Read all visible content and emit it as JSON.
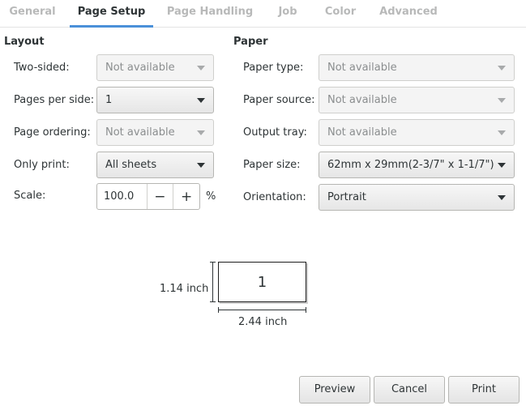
{
  "tabs": [
    "General",
    "Page Setup",
    "Page Handling",
    "Job",
    "Color",
    "Advanced"
  ],
  "layout": {
    "heading": "Layout",
    "two_sided": {
      "label": "Two-sided:",
      "value": "Not available"
    },
    "pages_per_side": {
      "label": "Pages per side:",
      "value": "1"
    },
    "page_ordering": {
      "label": "Page ordering:",
      "value": "Not available"
    },
    "only_print": {
      "label": "Only print:",
      "value": "All sheets"
    },
    "scale": {
      "label": "Scale:",
      "value": "100.0",
      "minus": "−",
      "plus": "+",
      "unit": "%"
    }
  },
  "paper": {
    "heading": "Paper",
    "paper_type": {
      "label": "Paper type:",
      "value": "Not available"
    },
    "paper_source": {
      "label": "Paper source:",
      "value": "Not available"
    },
    "output_tray": {
      "label": "Output tray:",
      "value": "Not available"
    },
    "paper_size": {
      "label": "Paper size:",
      "value": "62mm x 29mm(2-3/7\" x 1-1/7\")"
    },
    "orientation": {
      "label": "Orientation:",
      "value": "Portrait"
    }
  },
  "preview": {
    "page_number": "1",
    "height_label": "1.14 inch",
    "width_label": "2.44 inch"
  },
  "buttons": {
    "preview": "Preview",
    "cancel": "Cancel",
    "print": "Print"
  }
}
